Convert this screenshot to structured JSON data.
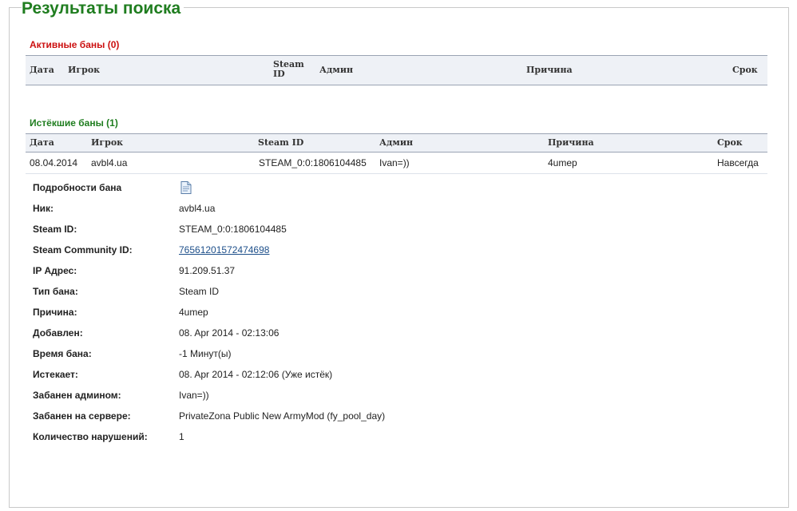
{
  "page_title": "Результаты поиска",
  "active_bans": {
    "title": "Активные баны (0)",
    "headers": {
      "date": "Дата",
      "player": "Игрок",
      "steam_id": "Steam ID",
      "admin": "Админ",
      "reason": "Причина",
      "term": "Срок"
    }
  },
  "expired_bans": {
    "title": "Истёкшие баны (1)",
    "headers": {
      "date": "Дата",
      "player": "Игрок",
      "steam_id": "Steam ID",
      "admin": "Админ",
      "reason": "Причина",
      "term": "Срок"
    },
    "rows": [
      {
        "date": "08.04.2014",
        "player": "avbl4.ua",
        "steam_id": "STEAM_0:0:1806104485",
        "admin": "Ivan=))",
        "reason": "4umep",
        "term": "Навсегда"
      }
    ]
  },
  "details": {
    "header_label": "Подробности бана",
    "icon": "document-icon",
    "fields": [
      {
        "label": "Ник:",
        "value": "avbl4.ua"
      },
      {
        "label": "Steam ID:",
        "value": "STEAM_0:0:1806104485"
      },
      {
        "label": "Steam Community ID:",
        "value": "76561201572474698"
      },
      {
        "label": "IP Адрес:",
        "value": "91.209.51.37"
      },
      {
        "label": "Тип бана:",
        "value": "Steam ID"
      },
      {
        "label": "Причина:",
        "value": "4umep"
      },
      {
        "label": "Добавлен:",
        "value": "08. Apr 2014 - 02:13:06"
      },
      {
        "label": "Время бана:",
        "value": "-1 Минут(ы)"
      },
      {
        "label": "Истекает:",
        "value": "08. Apr 2014 - 02:12:06 (Уже истёк)"
      },
      {
        "label": "Забанен админом:",
        "value": "Ivan=))"
      },
      {
        "label": "Забанен на сервере:",
        "value": "PrivateZona Public New ArmyMod (fy_pool_day)"
      },
      {
        "label": "Количество нарушений:",
        "value": "1"
      }
    ]
  },
  "colors": {
    "title_green": "#1f7d1f",
    "active_red": "#cc1111",
    "header_bg": "#eef1f6",
    "link": "#1d4f8a"
  }
}
